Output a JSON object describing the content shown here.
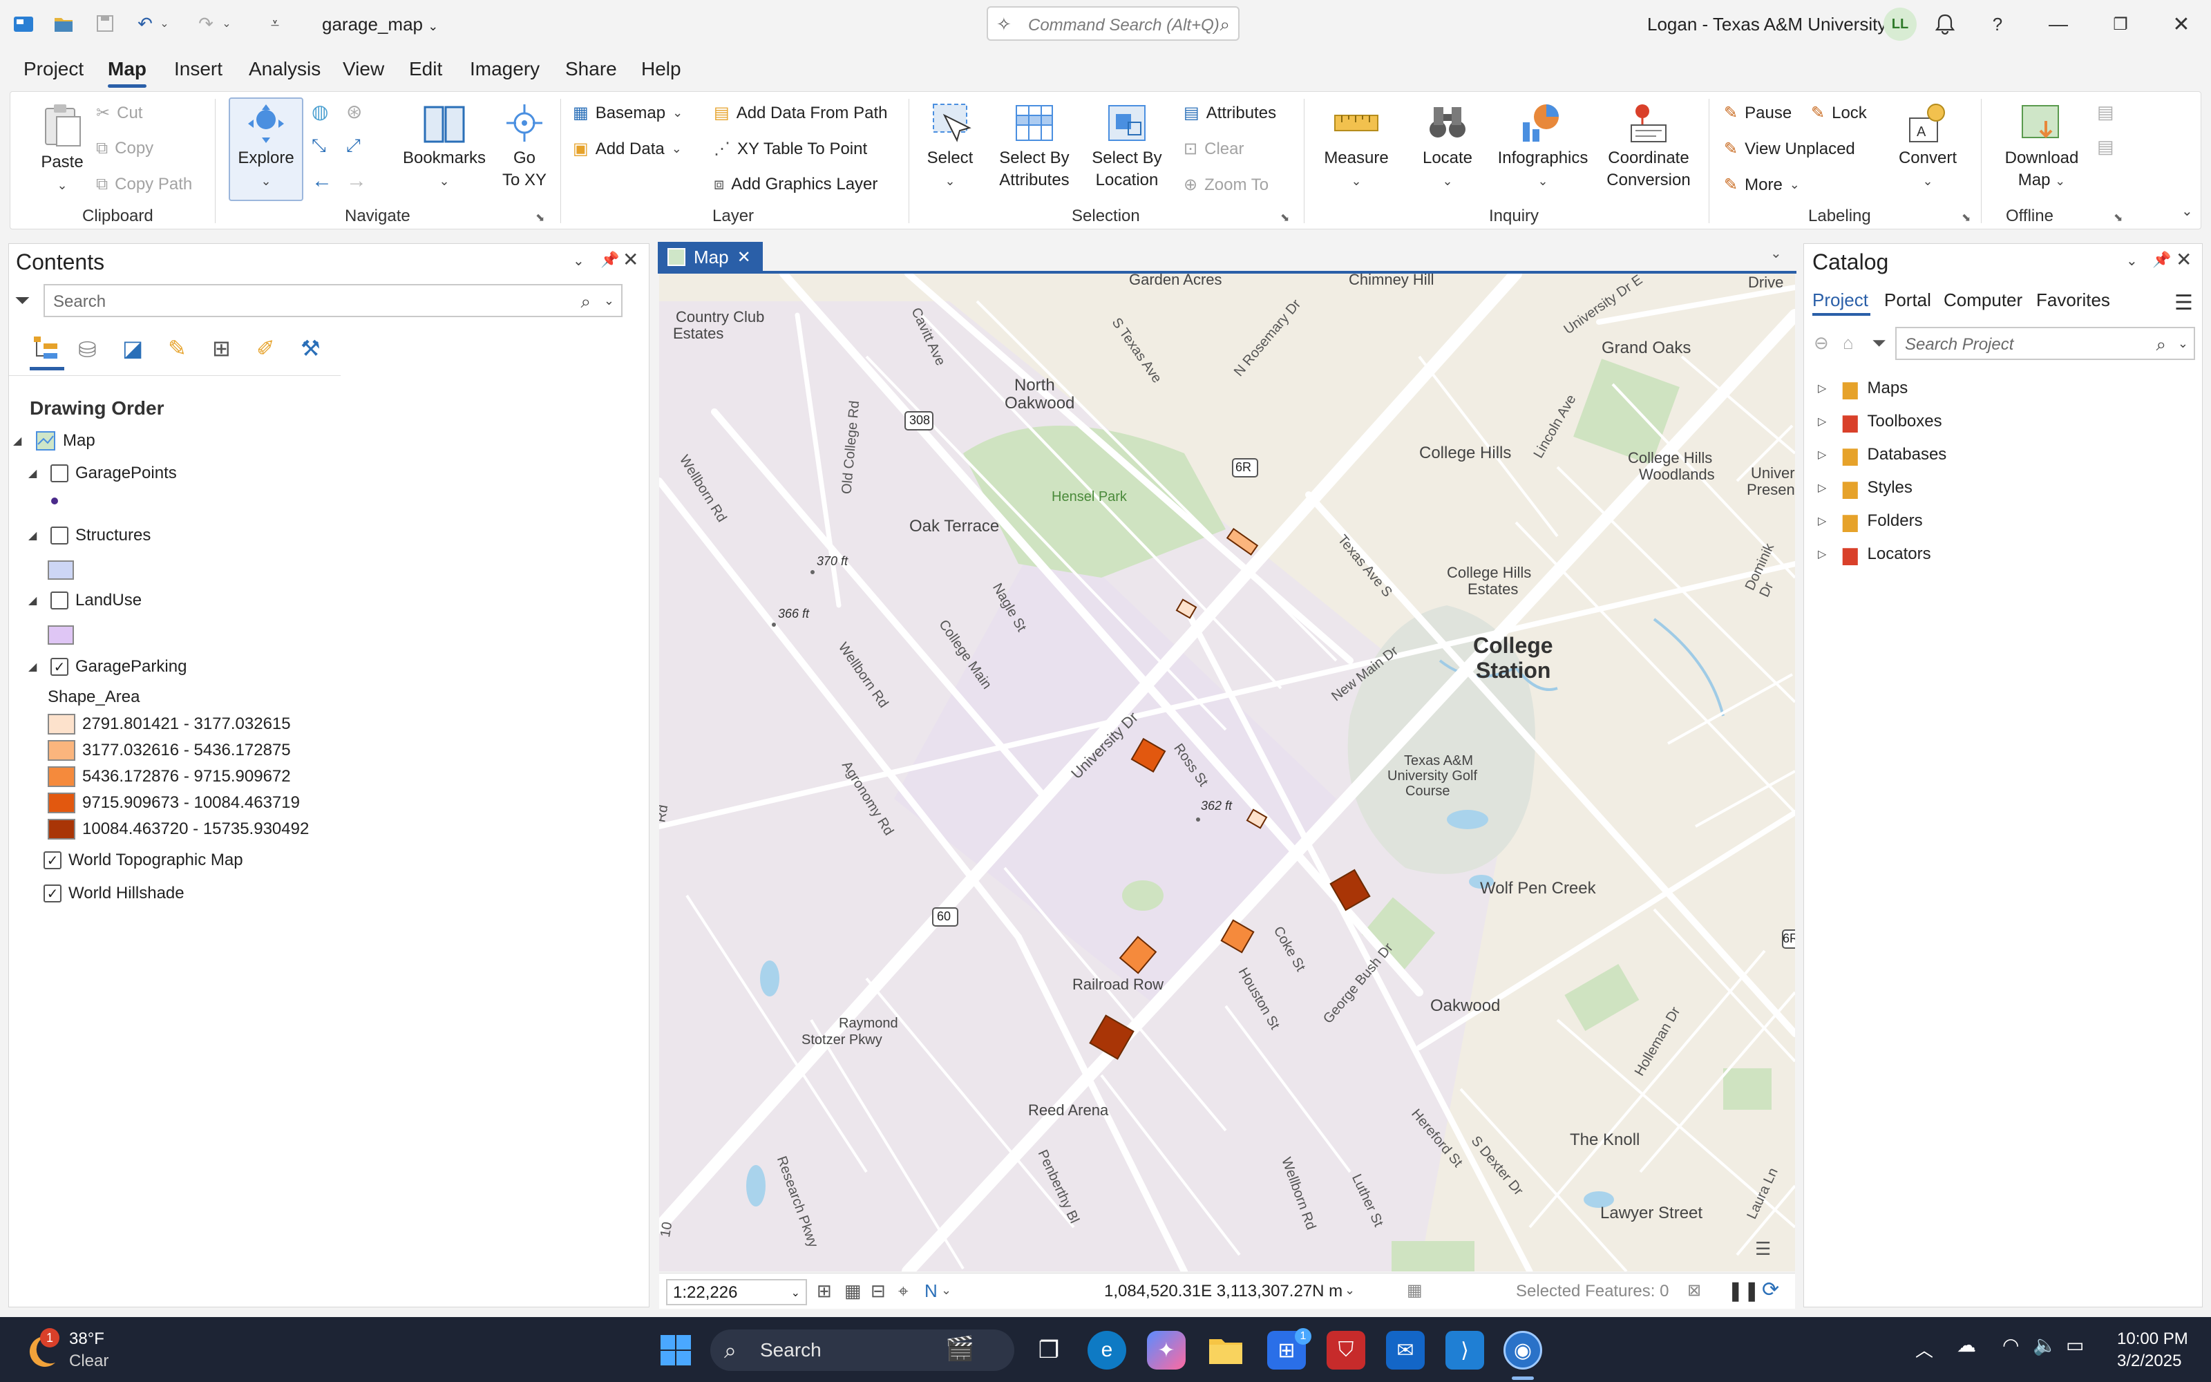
{
  "titlebar": {
    "project_name": "garage_map",
    "command_search_placeholder": "Command Search (Alt+Q)",
    "user": "Logan - Texas A&M University",
    "avatar_initials": "LL"
  },
  "menu": {
    "tabs": [
      "Project",
      "Map",
      "Insert",
      "Analysis",
      "View",
      "Edit",
      "Imagery",
      "Share",
      "Help"
    ],
    "active": "Map"
  },
  "ribbon": {
    "clipboard": {
      "group": "Clipboard",
      "paste": "Paste",
      "cut": "Cut",
      "copy": "Copy",
      "copy_path": "Copy Path"
    },
    "navigate": {
      "group": "Navigate",
      "explore": "Explore",
      "bookmarks": "Bookmarks",
      "go_to_xy_1": "Go",
      "go_to_xy_2": "To XY"
    },
    "layer": {
      "group": "Layer",
      "basemap": "Basemap",
      "add_data": "Add Data",
      "add_data_from_path": "Add Data From Path",
      "xy_table_to_point": "XY Table To Point",
      "add_graphics_layer": "Add Graphics Layer"
    },
    "selection": {
      "group": "Selection",
      "select": "Select",
      "select_by_attributes_1": "Select By",
      "select_by_attributes_2": "Attributes",
      "select_by_location_1": "Select By",
      "select_by_location_2": "Location",
      "attributes": "Attributes",
      "clear": "Clear",
      "zoom_to": "Zoom To"
    },
    "inquiry": {
      "group": "Inquiry",
      "measure": "Measure",
      "locate": "Locate",
      "infographics": "Infographics",
      "coord_conv_1": "Coordinate",
      "coord_conv_2": "Conversion"
    },
    "labeling": {
      "group": "Labeling",
      "pause": "Pause",
      "lock": "Lock",
      "view_unplaced": "View Unplaced",
      "more": "More",
      "convert": "Convert"
    },
    "offline": {
      "group": "Offline",
      "download_map_1": "Download",
      "download_map_2": "Map"
    }
  },
  "contents": {
    "title": "Contents",
    "search_placeholder": "Search",
    "section": "Drawing Order",
    "map_label": "Map",
    "layers": [
      {
        "name": "GaragePoints",
        "checked": false
      },
      {
        "name": "Structures",
        "checked": false
      },
      {
        "name": "LandUse",
        "checked": false
      },
      {
        "name": "GarageParking",
        "checked": true
      }
    ],
    "field": "Shape_Area",
    "classes": [
      {
        "label": "2791.801421 - 3177.032615",
        "color": "#fde2cc"
      },
      {
        "label": "3177.032616 - 5436.172875",
        "color": "#fbb57d"
      },
      {
        "label": "5436.172876 - 9715.909672",
        "color": "#f58a3c"
      },
      {
        "label": "9715.909673 - 10084.463719",
        "color": "#e2580f"
      },
      {
        "label": "10084.463720 - 15735.930492",
        "color": "#a93506"
      }
    ],
    "basemaps": [
      {
        "name": "World Topographic Map",
        "checked": true
      },
      {
        "name": "World Hillshade",
        "checked": true
      }
    ]
  },
  "map": {
    "tab": "Map",
    "labels": {
      "garden_acres": "Garden Acres",
      "chimney_hill": "Chimney Hill",
      "drive": "Drive",
      "country_club_estates_1": "Country Club",
      "country_club_estates_2": "Estates",
      "cavitt_ave": "Cavitt Ave",
      "s_texas_ave": "S Texas Ave",
      "n_rosemary": "N Rosemary Dr",
      "university_dr_e": "University Dr E",
      "grand_oaks": "Grand Oaks",
      "north_oakwood_1": "North",
      "north_oakwood_2": "Oakwood",
      "old_college_rd": "Old College Rd",
      "hwy_308": "308",
      "hwy_6r": "6R",
      "hensel_park": "Hensel Park",
      "college_hills": "College Hills",
      "lincoln_ave": "Lincoln Ave",
      "college_hills_woodlands_1": "College Hills",
      "college_hills_woodlands_2": "Woodlands",
      "univer_presen_1": "Univer",
      "univer_presen_2": "Presen",
      "wellborn_rd_1": "Wellborn Rd",
      "oak_terrace": "Oak Terrace",
      "elev_370": "370 ft",
      "elev_366": "366 ft",
      "nagle_st": "Nagle St",
      "texas_ave_s": "Texas Ave S",
      "college_hills_estates_1": "College Hills",
      "college_hills_estates_2": "Estates",
      "dominik_dr": "Dominik Dr",
      "wellborn_rd_2": "Wellborn Rd",
      "college_main": "College Main",
      "new_main_dr": "New Main Dr",
      "college_station_1": "College",
      "college_station_2": "Station",
      "university_dr": "University Dr",
      "ross_st": "Ross St",
      "golf_1": "Texas A&M",
      "golf_2": "University Golf",
      "golf_3": "Course",
      "agronomy_rd": "Agronomy Rd",
      "elev_362": "362 ft",
      "rd_left": "Rd",
      "hwy_60": "60",
      "wolf_pen_creek": "Wolf Pen Creek",
      "coke_st": "Coke St",
      "railroad_row": "Railroad Row",
      "houston_st": "Houston St",
      "george_bush_dr": "George Bush Dr",
      "oakwood": "Oakwood",
      "raymond_stotzer_1": "Raymond",
      "raymond_stotzer_2": "Stotzer Pkwy",
      "holleman_dr": "Holleman Dr",
      "reed_arena": "Reed Arena",
      "hereford_st": "Hereford St",
      "s_dexter_dr": "S Dexter Dr",
      "the_knoll": "The Knoll",
      "research_pkwy": "Research Pkwy",
      "penberthy_bl": "Penberthy Bl",
      "wellborn_rd_3": "Wellborn Rd",
      "luther_st": "Luther St",
      "lawyer_street": "Lawyer Street",
      "laura_ln": "Laura Ln",
      "hwy_6r_right": "6R",
      "edge_10": "10"
    },
    "scale": "1:22,226",
    "coordinates": "1,084,520.31E 3,113,307.27N m",
    "selected_features": "Selected Features: 0"
  },
  "catalog": {
    "title": "Catalog",
    "tabs": [
      "Project",
      "Portal",
      "Computer",
      "Favorites"
    ],
    "active_tab": "Project",
    "search_placeholder": "Search Project",
    "items": [
      "Maps",
      "Toolboxes",
      "Databases",
      "Styles",
      "Folders",
      "Locators"
    ]
  },
  "taskbar": {
    "weather_temp": "38°F",
    "weather_cond": "Clear",
    "weather_badge": "1",
    "search": "Search",
    "store_badge": "1",
    "time": "10:00 PM",
    "date": "3/2/2025"
  }
}
